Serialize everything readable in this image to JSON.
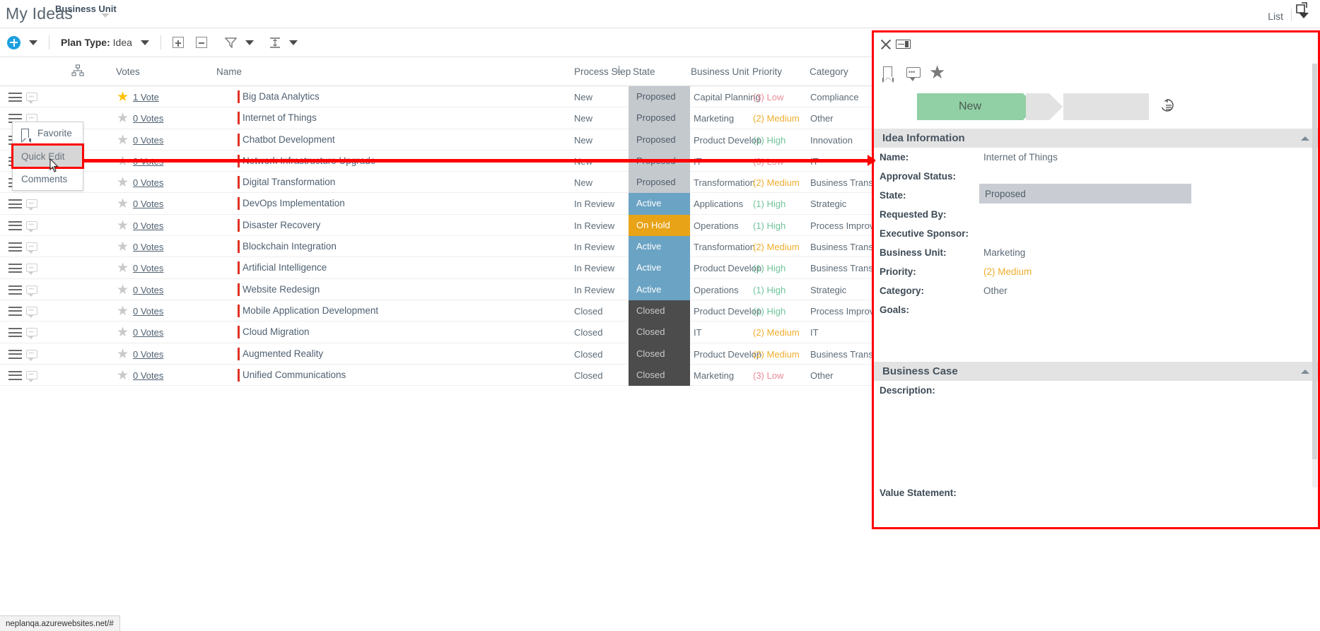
{
  "header": {
    "app_title": "My Ideas",
    "business_unit_label": "Business Unit",
    "view_label": "List"
  },
  "toolbar": {
    "add_label": "",
    "plan_type_prefix": "Plan Type:",
    "plan_type_value": "Idea"
  },
  "columns": {
    "hierarchy": "",
    "votes": "Votes",
    "name": "Name",
    "process_step": "Process Step",
    "state": "State",
    "business_unit": "Business Unit",
    "priority": "Priority",
    "category": "Category"
  },
  "context_menu": {
    "items": [
      {
        "label": "Favorite",
        "icon": "bookmark-icon",
        "highlighted": false
      },
      {
        "label": "Quick Edit",
        "icon": "",
        "highlighted": true
      },
      {
        "label": "Comments",
        "icon": "",
        "highlighted": false
      }
    ]
  },
  "rows": [
    {
      "favorite": true,
      "votes": "1 Vote",
      "name": "Big Data Analytics",
      "process_step": "New",
      "state": "Proposed",
      "state_class": "state-proposed",
      "business_unit": "Capital Planning",
      "priority": "(3) Low",
      "priority_class": "p-low",
      "category": "Compliance"
    },
    {
      "favorite": false,
      "votes": "0 Votes",
      "name": "Internet of Things",
      "process_step": "New",
      "state": "Proposed",
      "state_class": "state-proposed",
      "business_unit": "Marketing",
      "priority": "(2) Medium",
      "priority_class": "p-med",
      "category": "Other"
    },
    {
      "favorite": false,
      "votes": "0 Votes",
      "name": "Chatbot Development",
      "process_step": "New",
      "state": "Proposed",
      "state_class": "state-proposed",
      "business_unit": "Product Develop",
      "priority": "(1) High",
      "priority_class": "p-high",
      "category": "Innovation"
    },
    {
      "favorite": false,
      "votes": "0 Votes",
      "name": "Network Infrastructure Upgrade",
      "process_step": "New",
      "state": "Proposed",
      "state_class": "state-proposed",
      "business_unit": "IT",
      "priority": "(3) Low",
      "priority_class": "p-low",
      "category": "IT"
    },
    {
      "favorite": false,
      "votes": "0 Votes",
      "name": "Digital Transformation",
      "process_step": "New",
      "state": "Proposed",
      "state_class": "state-proposed",
      "business_unit": "Transformation",
      "priority": "(2) Medium",
      "priority_class": "p-med",
      "category": "Business Transfo"
    },
    {
      "favorite": false,
      "votes": "0 Votes",
      "name": "DevOps Implementation",
      "process_step": "In Review",
      "state": "Active",
      "state_class": "state-active",
      "business_unit": "Applications",
      "priority": "(1) High",
      "priority_class": "p-high",
      "category": "Strategic"
    },
    {
      "favorite": false,
      "votes": "0 Votes",
      "name": "Disaster Recovery",
      "process_step": "In Review",
      "state": "On Hold",
      "state_class": "state-onhold",
      "business_unit": "Operations",
      "priority": "(1) High",
      "priority_class": "p-high",
      "category": "Process Improve"
    },
    {
      "favorite": false,
      "votes": "0 Votes",
      "name": "Blockchain Integration",
      "process_step": "In Review",
      "state": "Active",
      "state_class": "state-active",
      "business_unit": "Transformation",
      "priority": "(2) Medium",
      "priority_class": "p-med",
      "category": "Business Transfo"
    },
    {
      "favorite": false,
      "votes": "0 Votes",
      "name": "Artificial Intelligence",
      "process_step": "In Review",
      "state": "Active",
      "state_class": "state-active",
      "business_unit": "Product Develop",
      "priority": "(1) High",
      "priority_class": "p-high",
      "category": "Business Transfo"
    },
    {
      "favorite": false,
      "votes": "0 Votes",
      "name": "Website Redesign",
      "process_step": "In Review",
      "state": "Active",
      "state_class": "state-active",
      "business_unit": "Operations",
      "priority": "(1) High",
      "priority_class": "p-high",
      "category": "Strategic"
    },
    {
      "favorite": false,
      "votes": "0 Votes",
      "name": "Mobile Application Development",
      "process_step": "Closed",
      "state": "Closed",
      "state_class": "state-closed",
      "business_unit": "Product Develop",
      "priority": "(1) High",
      "priority_class": "p-high",
      "category": "Process Improve"
    },
    {
      "favorite": false,
      "votes": "0 Votes",
      "name": "Cloud Migration",
      "process_step": "Closed",
      "state": "Closed",
      "state_class": "state-closed",
      "business_unit": "IT",
      "priority": "(2) Medium",
      "priority_class": "p-med",
      "category": "IT"
    },
    {
      "favorite": false,
      "votes": "0 Votes",
      "name": "Augmented Reality",
      "process_step": "Closed",
      "state": "Closed",
      "state_class": "state-closed",
      "business_unit": "Product Develop",
      "priority": "(2) Medium",
      "priority_class": "p-med",
      "category": "Business Transfo"
    },
    {
      "favorite": false,
      "votes": "0 Votes",
      "name": "Unified Communications",
      "process_step": "Closed",
      "state": "Closed",
      "state_class": "state-closed",
      "business_unit": "Marketing",
      "priority": "(3) Low",
      "priority_class": "p-low",
      "category": "Other"
    }
  ],
  "panel": {
    "stage_current": "New",
    "sections": {
      "idea_information": {
        "title": "Idea Information",
        "fields": [
          {
            "label": "Name:",
            "value": "Internet of Things",
            "style": "plain"
          },
          {
            "label": "Approval Status:",
            "value": "",
            "style": "plain"
          },
          {
            "label": "State:",
            "value": "Proposed",
            "style": "box"
          },
          {
            "label": "Requested By:",
            "value": "",
            "style": "plain"
          },
          {
            "label": "Executive Sponsor:",
            "value": "",
            "style": "plain"
          },
          {
            "label": "Business Unit:",
            "value": "Marketing",
            "style": "plain"
          },
          {
            "label": "Priority:",
            "value": "(2) Medium",
            "style": "medium"
          },
          {
            "label": "Category:",
            "value": "Other",
            "style": "plain"
          },
          {
            "label": "Goals:",
            "value": "",
            "style": "plain"
          }
        ]
      },
      "business_case": {
        "title": "Business Case",
        "fields": [
          {
            "label": "Description:",
            "value": "",
            "style": "plain"
          },
          {
            "label": "Value Statement:",
            "value": "",
            "style": "plain"
          }
        ]
      }
    }
  },
  "statusbar": {
    "url": "neplanqa.azurewebsites.net/#"
  },
  "colors": {
    "accent_blue": "#1b9fe0",
    "state_proposed": "#c4c9ce",
    "state_active": "#6aa3c4",
    "state_onhold": "#e8a317",
    "state_closed": "#4c4c4c",
    "priority_low": "#e98b96",
    "priority_medium": "#f0ad2e",
    "priority_high": "#6fc49a",
    "stage_green": "#91cfa4",
    "annotation_red": "#ff0000",
    "name_bar_red": "#e03226",
    "favorite_gold": "#fec202"
  }
}
